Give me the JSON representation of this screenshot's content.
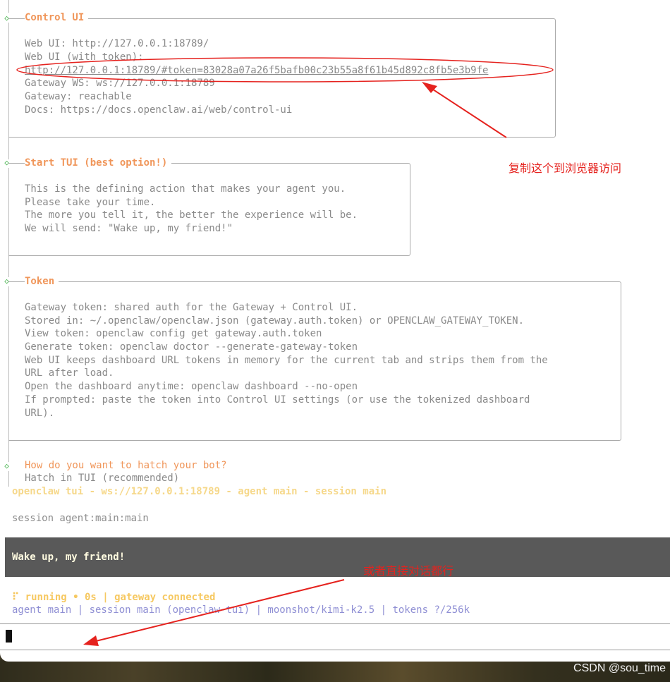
{
  "control_ui": {
    "title": "Control UI",
    "lines": [
      "Web UI: http://127.0.0.1:18789/",
      "Web UI (with token):",
      "http://127.0.0.1:18789/#token=83028a07a26f5bafb00c23b55a8f61b45d892c8fb5e3b9fe",
      "Gateway WS: ws://127.0.0.1:18789",
      "Gateway: reachable",
      "Docs: https://docs.openclaw.ai/web/control-ui"
    ]
  },
  "start_tui": {
    "title": "Start TUI (best option!)",
    "lines": [
      "This is the defining action that makes your agent you.",
      "Please take your time.",
      "The more you tell it, the better the experience will be.",
      "We will send: \"Wake up, my friend!\""
    ]
  },
  "token": {
    "title": "Token",
    "lines": [
      "Gateway token: shared auth for the Gateway + Control UI.",
      "Stored in: ~/.openclaw/openclaw.json (gateway.auth.token) or OPENCLAW_GATEWAY_TOKEN.",
      "View token: openclaw config get gateway.auth.token",
      "Generate token: openclaw doctor --generate-gateway-token",
      "Web UI keeps dashboard URL tokens in memory for the current tab and strips them from the",
      "URL after load.",
      "Open the dashboard anytime: openclaw dashboard --no-open",
      "If prompted: paste the token into Control UI settings (or use the tokenized dashboard",
      "URL)."
    ]
  },
  "hatch": {
    "question": "How do you want to hatch your bot?",
    "answer": "Hatch in TUI (recommended)"
  },
  "tui": {
    "header": "openclaw tui - ws://127.0.0.1:18789 - agent main - session main",
    "session": "session agent:main:main",
    "message": "Wake up, my friend!",
    "status": "⠏ running • 0s | gateway connected",
    "info": "agent main | session main (openclaw-tui) | moonshot/kimi-k2.5 | tokens ?/256k"
  },
  "annotations": {
    "copy_to_browser": "复制这个到浏览器访问",
    "or_chat_directly": "或者直接对话都行"
  },
  "watermark": "CSDN @sou_time",
  "colors": {
    "accent_orange": "#f0965a",
    "header_yellow": "#f6d88a",
    "info_purple": "#8f8fd4",
    "annotation_red": "#e5221e",
    "diamond_green": "#3cb043"
  }
}
